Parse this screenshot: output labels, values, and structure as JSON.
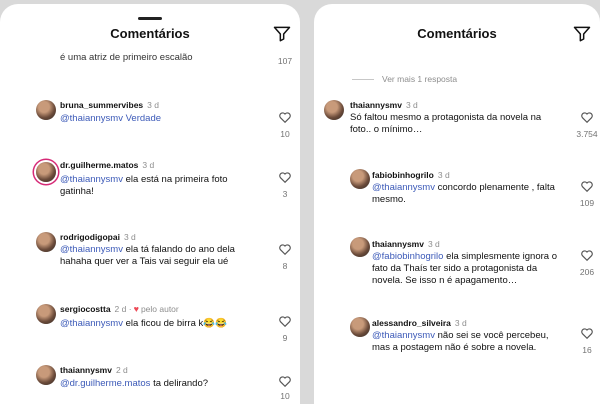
{
  "left": {
    "title": "Comentários",
    "top_partial": {
      "text": "é uma atriz de primeiro escalão",
      "likes": "107"
    },
    "comments": [
      {
        "user": "bruna_summervibes",
        "time": "3 d",
        "mention": "",
        "text": "@thaiannysmv Verdade",
        "likes": "10"
      },
      {
        "user": "dr.guilherme.matos",
        "time": "3 d",
        "mention": "@thaiannysmv",
        "text": " ela está na primeira foto",
        "line2": "gatinha!",
        "likes": "3"
      },
      {
        "user": "rodrigodigopai",
        "time": "3 d",
        "mention": "@thaiannysmv",
        "text": " ela tá falando do ano dela",
        "line2": "hahaha quer ver a Tais vai seguir ela ué",
        "likes": "8"
      },
      {
        "user": "sergiocostta",
        "time": "2 d",
        "author_note": "pelo autor",
        "mention": "@thaiannysmv",
        "text": " ela ficou de birra k😂😂",
        "likes": "9"
      },
      {
        "user": "thaiannysmv",
        "time": "2 d",
        "mention": "@dr.guilherme.matos",
        "text": " ta delirando?",
        "likes": "10"
      }
    ]
  },
  "right": {
    "title": "Comentários",
    "more_replies": "Ver mais 1 resposta",
    "comments": [
      {
        "user": "thaiannysmv",
        "time": "3 d",
        "text": "Só faltou mesmo a protagonista da novela na",
        "line2": "foto.. o mínimo…",
        "likes": "3.754"
      },
      {
        "user": "fabiobinhogrilo",
        "time": "3 d",
        "mention": "@thaiannysmv",
        "text": " concordo plenamente , falta",
        "line2": "mesmo.",
        "likes": "109"
      },
      {
        "user": "thaiannysmv",
        "time": "3 d",
        "mention": "@fabiobinhogrilo",
        "text": " ela simplesmente ignora o",
        "line2": "fato da Thaís ter sido a protagonista da",
        "line3": "novela. Se isso n é apagamento…",
        "likes": "206"
      },
      {
        "user": "alessandro_silveira",
        "time": "3 d",
        "mention": "@thaiannysmv",
        "text": " não sei se você percebeu,",
        "line2": "mas a postagem não é sobre a novela.",
        "likes": "16"
      }
    ]
  },
  "icons": {
    "filter": "send-filter-icon",
    "like": "heart-outline-icon",
    "author_like": "heart-filled-icon"
  }
}
